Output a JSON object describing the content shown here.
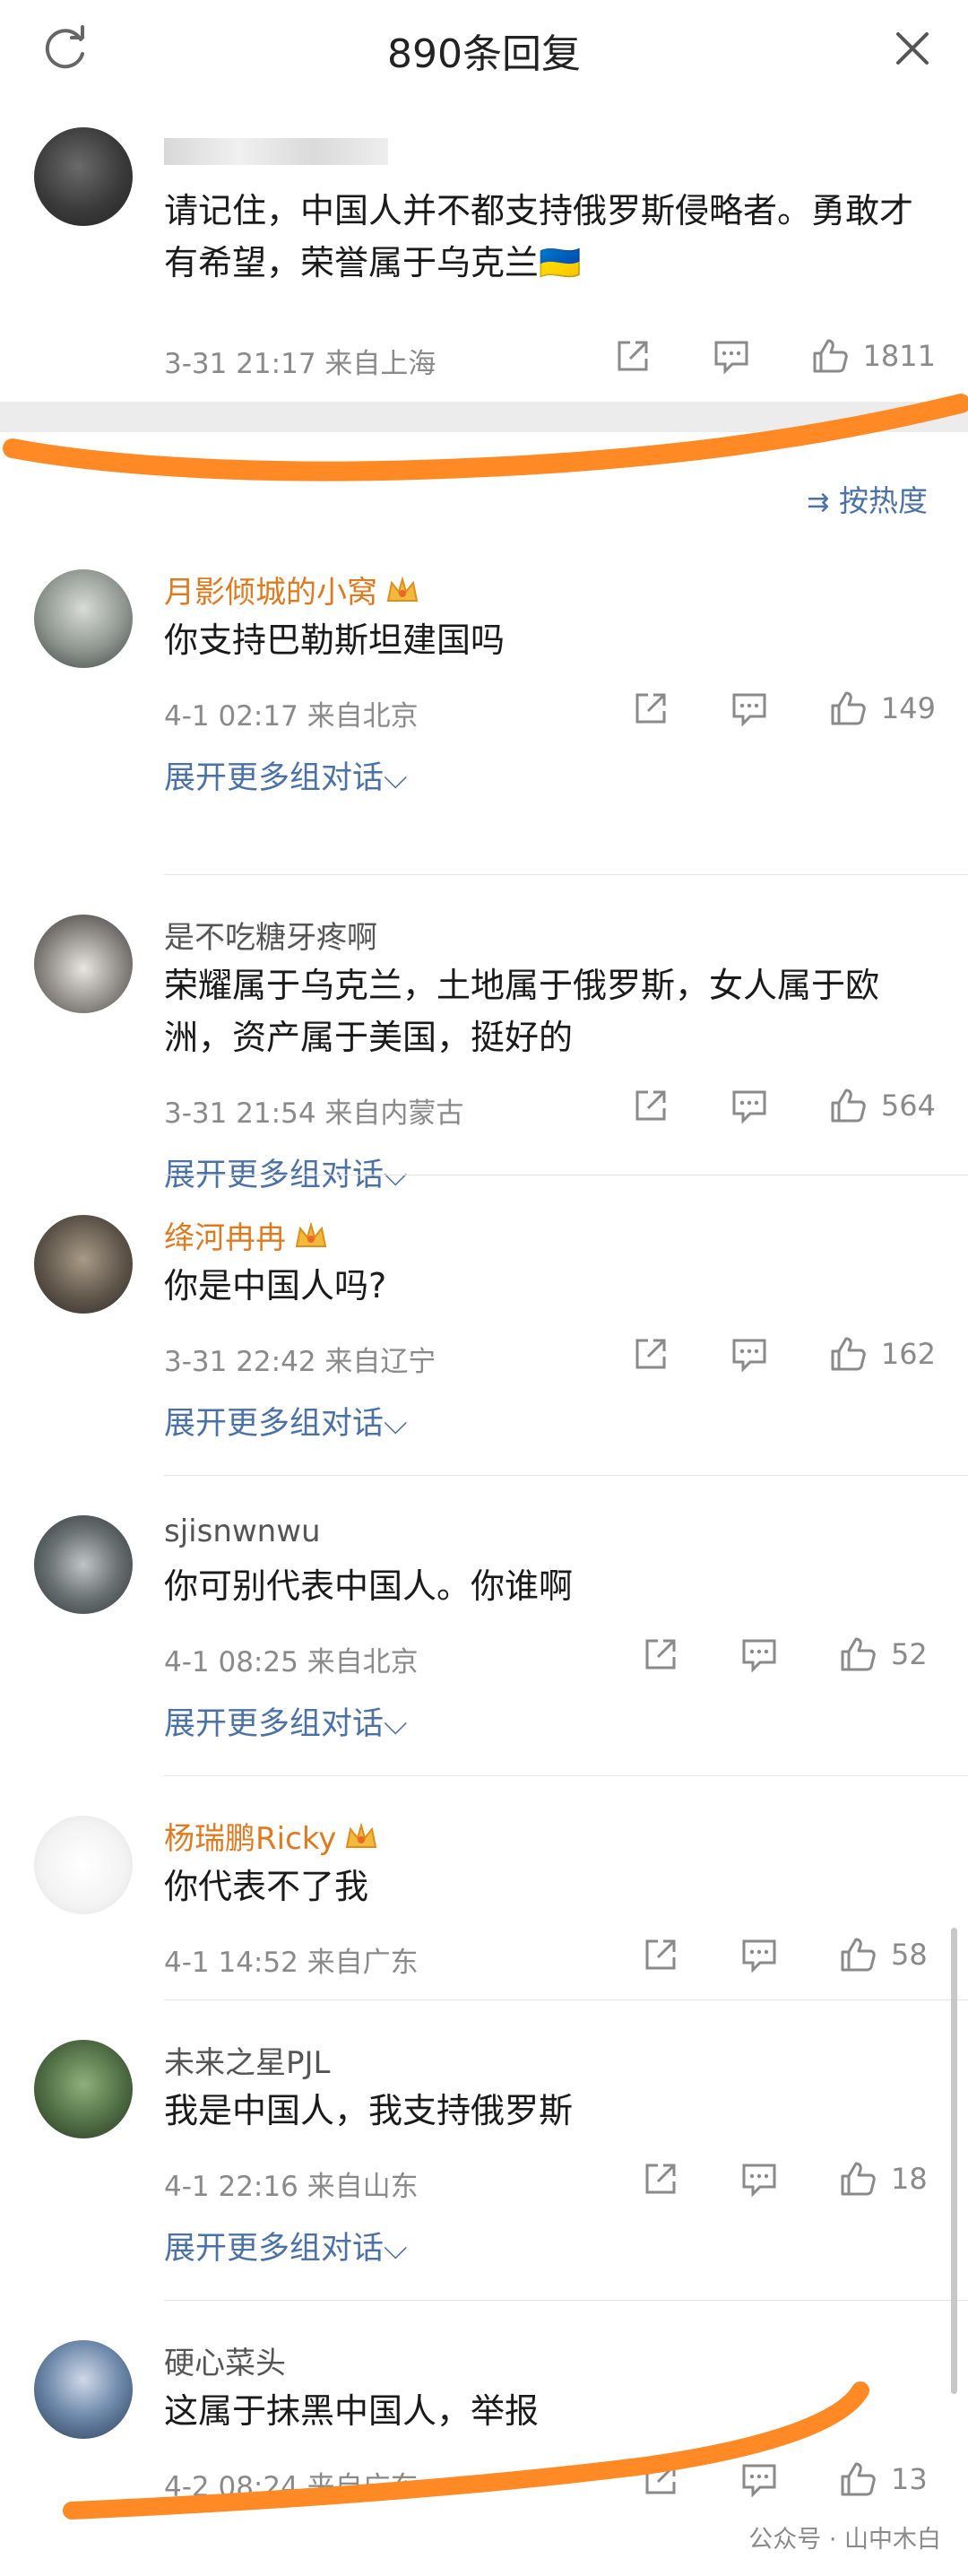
{
  "header": {
    "title": "890条回复"
  },
  "top_comment": {
    "text": "请记住，中国人并不都支持俄罗斯侵略者。勇敢才有希望，荣誉属于乌克兰🇺🇦",
    "meta": "3-31 21:17 来自上海",
    "likes": "1811"
  },
  "sort_label": "按热度",
  "expand_label": "展开更多组对话⌵",
  "replies": [
    {
      "user": "月影倾城的小窝",
      "text": "你支持巴勒斯坦建国吗",
      "meta": "4-1 02:17 来自北京",
      "likes": "149"
    },
    {
      "user": "是不吃糖牙疼啊",
      "text": "荣耀属于乌克兰，土地属于俄罗斯，女人属于欧洲，资产属于美国，挺好的",
      "meta": "3-31 21:54 来自内蒙古",
      "likes": "564"
    },
    {
      "user": "绛河冉冉",
      "text": "你是中国人吗?",
      "meta": "3-31 22:42 来自辽宁",
      "likes": "162"
    },
    {
      "user": "sjisnwnwu",
      "text": "你可别代表中国人。你谁啊",
      "meta": "4-1 08:25 来自北京",
      "likes": "52"
    },
    {
      "user": "杨瑞鹏Ricky",
      "text": "你代表不了我",
      "meta": "4-1 14:52 来自广东",
      "likes": "58"
    },
    {
      "user": "未来之星PJL",
      "text": "我是中国人，我支持俄罗斯",
      "meta": "4-1 22:16 来自山东",
      "likes": "18"
    },
    {
      "user": "硬心菜头",
      "text": "这属于抹黑中国人，举报",
      "meta": "4-2 08:24 来自广东",
      "likes": "13"
    }
  ],
  "watermark": "公众号 · 山中木白",
  "colors": {
    "accent_link": "#4b72a8",
    "vip_name": "#e07a1f",
    "annotation_stroke": "#ff8a25"
  }
}
